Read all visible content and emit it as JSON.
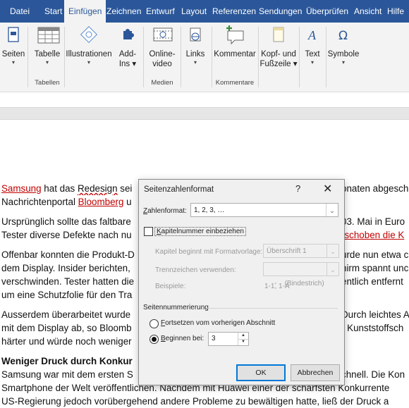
{
  "tabs": [
    "Datei",
    "Start",
    "Einfügen",
    "Zeichnen",
    "Entwurf",
    "Layout",
    "Referenzen",
    "Sendungen",
    "Überprüfen",
    "Ansicht",
    "Hilfe"
  ],
  "active_tab": "Einfügen",
  "ribbon": {
    "pages": {
      "line1": "Seiten",
      "line2": "▾"
    },
    "table": {
      "line1": "Tabelle",
      "line2": "▾"
    },
    "illustrations": {
      "line1": "Illustrationen",
      "line2": "▾"
    },
    "addins": {
      "line1": "Add-",
      "line2": "Ins ▾"
    },
    "online_video": {
      "line1": "Online-",
      "line2": "video"
    },
    "links": {
      "line1": "Links",
      "line2": "▾"
    },
    "comment": {
      "line1": "Kommentar",
      "line2": ""
    },
    "header_footer": {
      "line1": "Kopf- und",
      "line2": "Fußzeile ▾"
    },
    "text": {
      "line1": "Text",
      "line2": "▾"
    },
    "symbols": {
      "line1": "Symbole",
      "line2": "▾"
    },
    "groups": {
      "tables": "Tabellen",
      "media": "Medien",
      "comments": "Kommentare"
    }
  },
  "document": {
    "p1a_link": "Samsung",
    "p1a_rest": " hat das ",
    "p1a_squig": "Redesign",
    "p1a_tail": " sei",
    "p1a_right": "onaten abgesch",
    "p1b_left": "Nachrichtenportal ",
    "p1b_link": "Bloomberg",
    "p1b_tail": " u",
    "p2a_left": "Ursprünglich sollte das faltbare",
    "p2a_right": "03. Mai in Euro",
    "p2b_left": "Tester diverse Defekte nach nu",
    "p2b_right": "rschoben die K",
    "p3a_left": "Offenbar konnten die Produkt-D",
    "p3a_right": "urde nun etwa c",
    "p3b_left": "dem Display. Insider berichten,",
    "p3b_right": "hirm spannt unc",
    "p3c_left": "verschwinden. Tester hatten die",
    "p3c_right": "entlich entfernt",
    "p3d_left": "um eine Schutzfolie für den Tra",
    "p4a_left": "Ausserdem überarbeitet wurde",
    "p4a_right": "Durch leichtes A",
    "p4b_left": "mit dem Display ab, so Bloomb",
    "p4b_right": "r Kunststoffsch",
    "p4c_left": "härter und würde noch weniger",
    "heading": "Weniger Druck durch Konkur",
    "p5a_left": "Samsung war mit dem ersten S",
    "p5a_right": "chnell. Die Kon",
    "p5b": "Smartphone der Welt veröffentlichen. Nachdem mit Huawei einer der schärfsten Konkurrente",
    "p5c": "US-Regierung jedoch vorübergehend andere Probleme zu bewältigen hatte, ließ der Druck a"
  },
  "dialog": {
    "title": "Seitenzahlenformat",
    "help": "?",
    "close": "✕",
    "number_format_label_u": "Z",
    "number_format_label_rest": "ahlenformat:",
    "number_format_value": "1, 2, 3, …",
    "include_chapter_u": "K",
    "include_chapter_rest": "apitelnummer einbeziehen",
    "chapter_style_label": "Kapitel beginnt mit Formatvorlage:",
    "chapter_style_value": "Überschrift 1",
    "separator_label": "Trennzeichen verwenden:",
    "separator_value": "-    (Bindestrich)",
    "examples_label": "Beispiele:",
    "examples_value": "1-1, 1-A",
    "numbering_section": "Seitennummerierung",
    "continue_u": "F",
    "continue_rest": "ortsetzen vom vorherigen Abschnitt",
    "start_at_u": "B",
    "start_at_rest": "eginnen bei:",
    "start_at_value": "3",
    "ok": "OK",
    "cancel": "Abbrechen"
  }
}
